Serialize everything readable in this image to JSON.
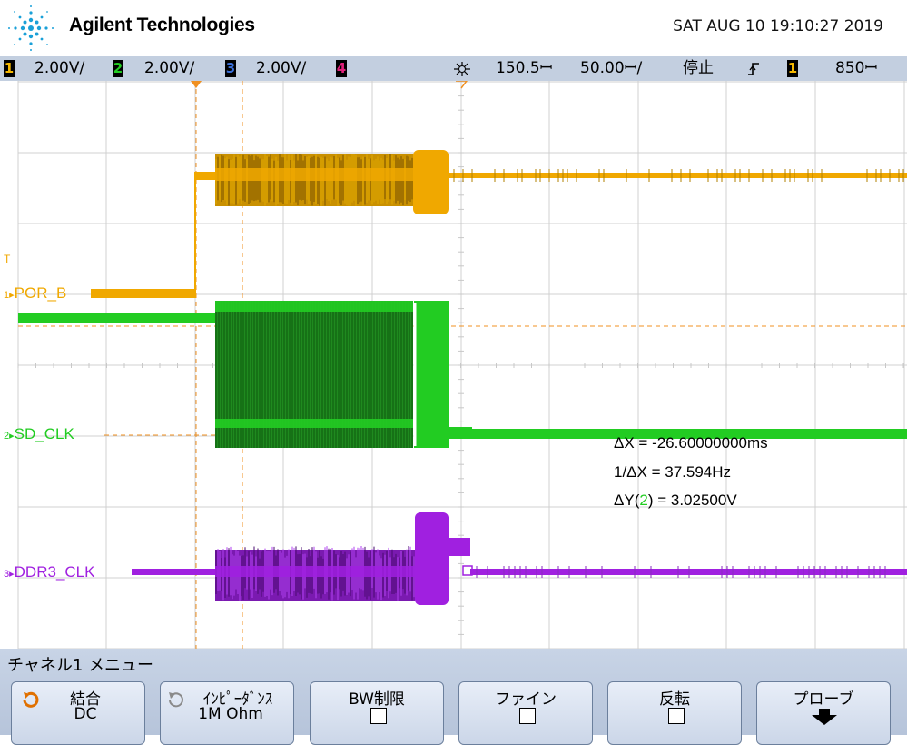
{
  "header": {
    "brand": "Agilent Technologies",
    "datetime": "SAT AUG 10 19:10:27 2019"
  },
  "status": {
    "ch1": {
      "num": "1",
      "scale": "2.00V/",
      "color": "#f5b800"
    },
    "ch2": {
      "num": "2",
      "scale": "2.00V/",
      "color": "#22cc22"
    },
    "ch3": {
      "num": "3",
      "scale": "2.00V/",
      "color": "#3a6fd8"
    },
    "ch4": {
      "num": "4",
      "color": "#e0207a"
    },
    "delay": "150.5ꟷ",
    "timebase": "50.00ꟷ/",
    "run_state": "停止",
    "trigger_source": "1",
    "trigger_level": "850ꟷ"
  },
  "channels": [
    {
      "num": "1",
      "name": "POR_B",
      "color": "#f0a800"
    },
    {
      "num": "2",
      "name": "SD_CLK",
      "color": "#22cc22"
    },
    {
      "num": "3",
      "name": "DDR3_CLK",
      "color": "#a020e0"
    }
  ],
  "trigger_marker": "T",
  "measurements": {
    "dx": "ΔX = -26.60000000ms",
    "inv_dx": "1/ΔX = 37.594Hz",
    "dy_prefix": "ΔY(",
    "dy_channel": "2",
    "dy_suffix": ") = 3.02500V"
  },
  "menu": {
    "title": "チャネル1 メニュー",
    "softkeys": [
      {
        "label": "結合",
        "value": "DC"
      },
      {
        "label": "ｲﾝﾋﾟｰﾀﾞﾝｽ",
        "value": "1M Ohm"
      },
      {
        "label": "BW制限"
      },
      {
        "label": "ファイン"
      },
      {
        "label": "反転"
      },
      {
        "label": "プローブ"
      }
    ]
  }
}
